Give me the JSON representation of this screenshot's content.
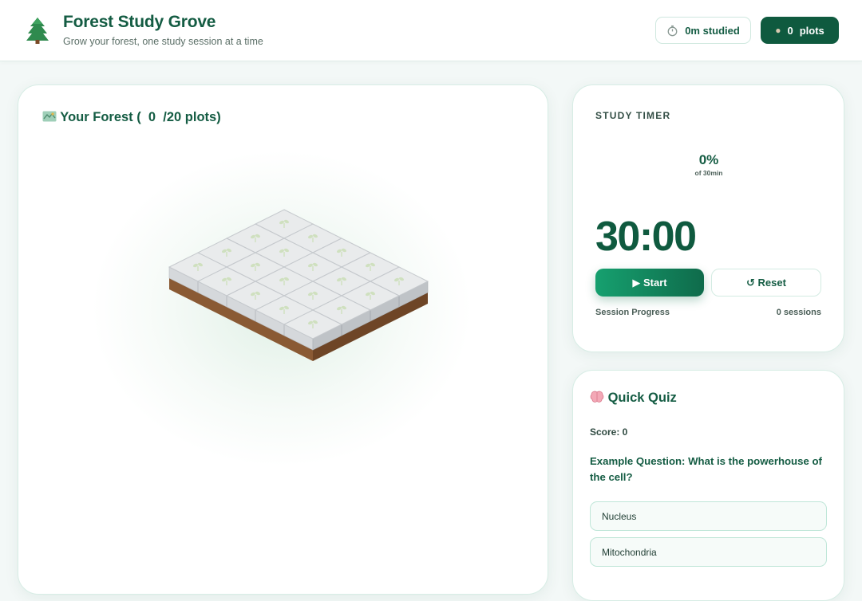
{
  "header": {
    "logo_icon": "pine-tree-icon",
    "title": "Forest Study Grove",
    "subtitle": "Grow your forest, one study session at a time",
    "studied_icon": "stopwatch-icon",
    "studied_label": "0m studied",
    "plots_icon": "tree-icon",
    "plots_count": "0",
    "plots_label": "plots"
  },
  "forest": {
    "title_icon": "map-icon",
    "title_prefix": "Your Forest (",
    "planted": "0",
    "title_suffix": "/20 plots)",
    "plot_total": 20,
    "grid_columns": 5,
    "grid_rows": 4,
    "plot_state": "empty"
  },
  "timer": {
    "label": "STUDY TIMER",
    "percent": "0%",
    "percent_sub": "of 30min",
    "time": "30:00",
    "start_label": "▶ Start",
    "reset_label": "↺ Reset",
    "progress_label": "Session Progress",
    "sessions": "0 sessions"
  },
  "quiz": {
    "title_icon": "brain-icon",
    "title": "Quick Quiz",
    "score": "Score: 0",
    "question": "Example Question: What is the powerhouse of the cell?",
    "options": [
      "Nucleus",
      "Mitochondria"
    ]
  },
  "colors": {
    "brand": "#145c43",
    "accent": "#16a06f",
    "tile": "#e9ebec",
    "soil": "#8a5a34",
    "sprout": "#cfe0bf"
  }
}
